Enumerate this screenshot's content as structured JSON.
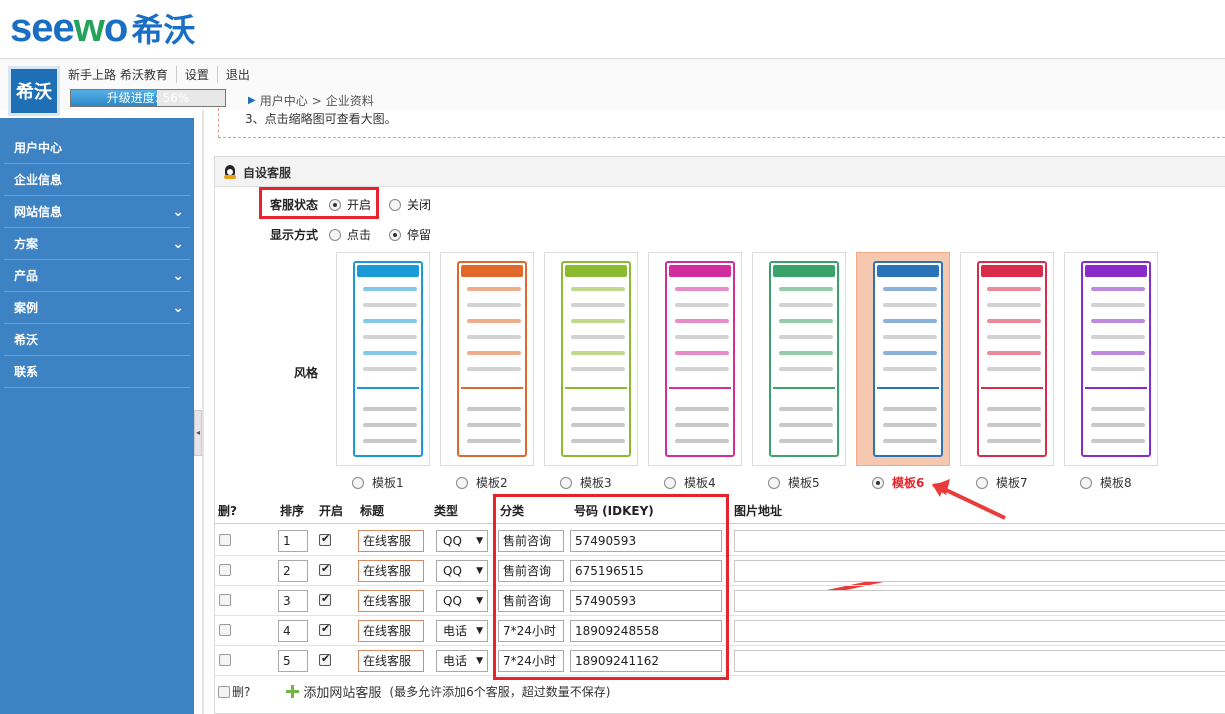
{
  "brand": {
    "logo_latin": "seewo",
    "logo_cn": "希沃"
  },
  "header": {
    "avatar_text": "希沃",
    "links": [
      "新手上路",
      "希沃教育",
      "设置",
      "退出"
    ],
    "progress_label": "升级进度: 56%",
    "progress_value": 0.56,
    "breadcrumb": [
      "用户中心",
      "企业资料"
    ],
    "breadcrumb_sep": ">"
  },
  "sidebar": {
    "items": [
      {
        "label": "用户中心",
        "has_chevron": false
      },
      {
        "label": "企业信息",
        "has_chevron": false
      },
      {
        "label": "网站信息",
        "has_chevron": true
      },
      {
        "label": "方案",
        "has_chevron": true
      },
      {
        "label": "产品",
        "has_chevron": true
      },
      {
        "label": "案例",
        "has_chevron": true
      },
      {
        "label": "希沃",
        "has_chevron": false
      },
      {
        "label": "联系",
        "has_chevron": false
      }
    ],
    "chevron_glyph": "⌄",
    "collapse_glyph": "◂"
  },
  "notice": "3、点击缩略图可查看大图。",
  "section": {
    "title": "自设客服",
    "status_label": "客服状态",
    "status_options": [
      {
        "label": "开启",
        "checked": true
      },
      {
        "label": "关闭",
        "checked": false
      }
    ],
    "display_label": "显示方式",
    "display_options": [
      {
        "label": "点击",
        "checked": false
      },
      {
        "label": "停留",
        "checked": true
      }
    ],
    "style_label": "风格",
    "templates": [
      {
        "label": "模板1",
        "color": "#1b9ad8",
        "selected": false
      },
      {
        "label": "模板2",
        "color": "#e2672a",
        "selected": false
      },
      {
        "label": "模板3",
        "color": "#8dbb2f",
        "selected": false
      },
      {
        "label": "模板4",
        "color": "#d22d9e",
        "selected": false
      },
      {
        "label": "模板5",
        "color": "#3aa36a",
        "selected": false
      },
      {
        "label": "模板6",
        "color": "#2b73b9",
        "selected": true
      },
      {
        "label": "模板7",
        "color": "#d92b4a",
        "selected": false
      },
      {
        "label": "模板8",
        "color": "#8a2bc9",
        "selected": false
      }
    ]
  },
  "table": {
    "headers": [
      "删?",
      "排序",
      "开启",
      "标题",
      "类型",
      "分类",
      "号码 (IDKEY)",
      "图片地址"
    ],
    "rows": [
      {
        "order": "1",
        "enabled": true,
        "title": "在线客服",
        "type": "QQ",
        "category": "售前咨询",
        "number": "57490593"
      },
      {
        "order": "2",
        "enabled": true,
        "title": "在线客服",
        "type": "QQ",
        "category": "售前咨询",
        "number": "675196515"
      },
      {
        "order": "3",
        "enabled": true,
        "title": "在线客服",
        "type": "QQ",
        "category": "售前咨询",
        "number": "57490593"
      },
      {
        "order": "4",
        "enabled": true,
        "title": "在线客服",
        "type": "电话",
        "category": "7*24小时",
        "number": "18909248558"
      },
      {
        "order": "5",
        "enabled": true,
        "title": "在线客服",
        "type": "电话",
        "category": "7*24小时",
        "number": "18909241162"
      }
    ],
    "select_arrow": "▼"
  },
  "footer": {
    "delete_label": "删?",
    "add_label": "添加网站客服",
    "note": "(最多允许添加6个客服，超过数量不保存)"
  },
  "colors": {
    "sidebar": "#3d82c3",
    "highlight": "#e8232b",
    "brand": "#1a6fc4"
  }
}
